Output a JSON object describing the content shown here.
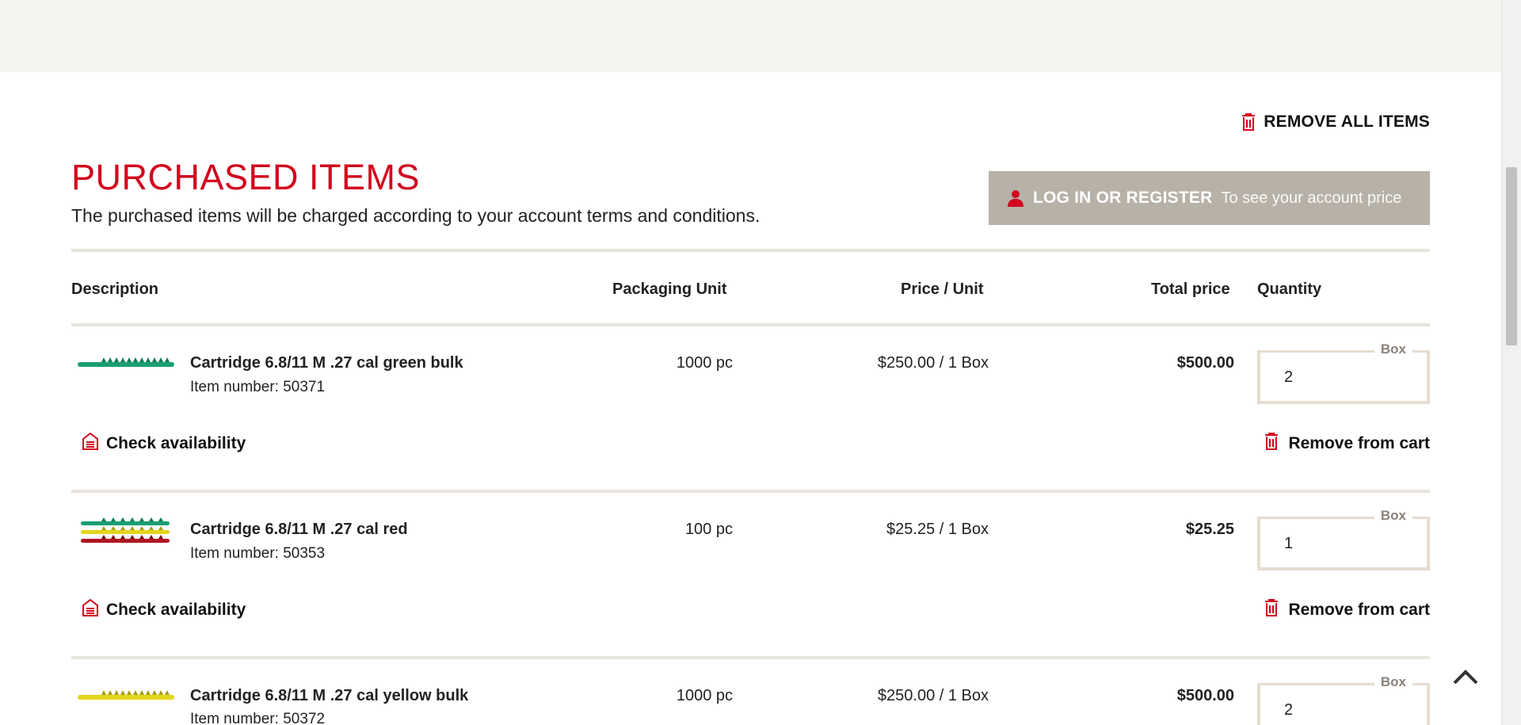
{
  "header": {
    "remove_all_label": "REMOVE ALL ITEMS",
    "title": "PURCHASED ITEMS",
    "subtitle": "The purchased items will be charged according to your account terms and conditions.",
    "login_label": "LOG IN OR REGISTER",
    "login_sub": "To see your account price"
  },
  "table": {
    "columns": [
      "Description",
      "Packaging Unit",
      "Price / Unit",
      "Total price",
      "Quantity"
    ]
  },
  "items": [
    {
      "name": "Cartridge 6.8/11 M .27 cal green bulk",
      "item_number": "Item number: 50371",
      "packaging": "1000 pc",
      "price_unit": "$250.00 / 1 Box",
      "total": "$500.00",
      "qty_label": "Box",
      "qty": "2",
      "check_label": "Check availability",
      "remove_label": "Remove from cart"
    },
    {
      "name": "Cartridge 6.8/11 M .27 cal red",
      "item_number": "Item number: 50353",
      "packaging": "100 pc",
      "price_unit": "$25.25 / 1 Box",
      "total": "$25.25",
      "qty_label": "Box",
      "qty": "1",
      "check_label": "Check availability",
      "remove_label": "Remove from cart"
    },
    {
      "name": "Cartridge 6.8/11 M .27 cal yellow bulk",
      "item_number": "Item number: 50372",
      "packaging": "1000 pc",
      "price_unit": "$250.00 / 1 Box",
      "total": "$500.00",
      "qty_label": "Box",
      "qty": "2"
    }
  ],
  "colors": {
    "brand_red": "#d2051e",
    "login_bg": "#b7b1a7",
    "divider": "#e8e4de",
    "top_band": "#f5f4f1"
  },
  "icons": {
    "trash": "trash-icon",
    "user": "user-icon",
    "warehouse": "warehouse-icon",
    "back_to_top": "chevron-up-icon"
  }
}
